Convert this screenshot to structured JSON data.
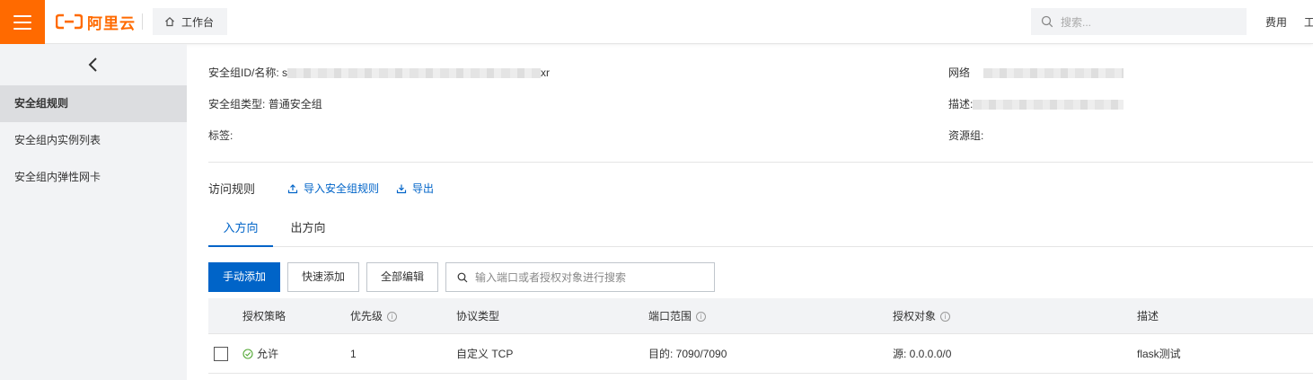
{
  "header": {
    "logo_text": "阿里云",
    "workbench_label": "工作台",
    "search_placeholder": "搜索...",
    "links": [
      "费用",
      "工"
    ]
  },
  "sidebar": {
    "items": [
      {
        "label": "安全组规则",
        "active": true
      },
      {
        "label": "安全组内实例列表",
        "active": false
      },
      {
        "label": "安全组内弹性网卡",
        "active": false
      }
    ]
  },
  "info": {
    "id_label": "安全组ID/名称:",
    "id_prefix": "s",
    "id_suffix": "xr",
    "network_label": "网络",
    "type_label": "安全组类型:",
    "type_value": "普通安全组",
    "desc_label": "描述:",
    "tags_label": "标签:",
    "resource_group_label": "资源组:"
  },
  "rules": {
    "title": "访问规则",
    "import_label": "导入安全组规则",
    "export_label": "导出"
  },
  "tabs": [
    {
      "label": "入方向",
      "active": true
    },
    {
      "label": "出方向",
      "active": false
    }
  ],
  "toolbar": {
    "manual_add": "手动添加",
    "quick_add": "快速添加",
    "edit_all": "全部编辑",
    "search_placeholder": "输入端口或者授权对象进行搜索"
  },
  "table": {
    "columns": [
      "授权策略",
      "优先级",
      "协议类型",
      "端口范围",
      "授权对象",
      "描述"
    ],
    "rows": [
      {
        "policy": "允许",
        "priority": "1",
        "protocol": "自定义 TCP",
        "port": "目的: 7090/7090",
        "source": "源: 0.0.0.0/0",
        "desc": "flask测试"
      }
    ]
  },
  "colors": {
    "brand": "#ff6a00",
    "primary": "#0064c8",
    "success": "#52a834"
  }
}
